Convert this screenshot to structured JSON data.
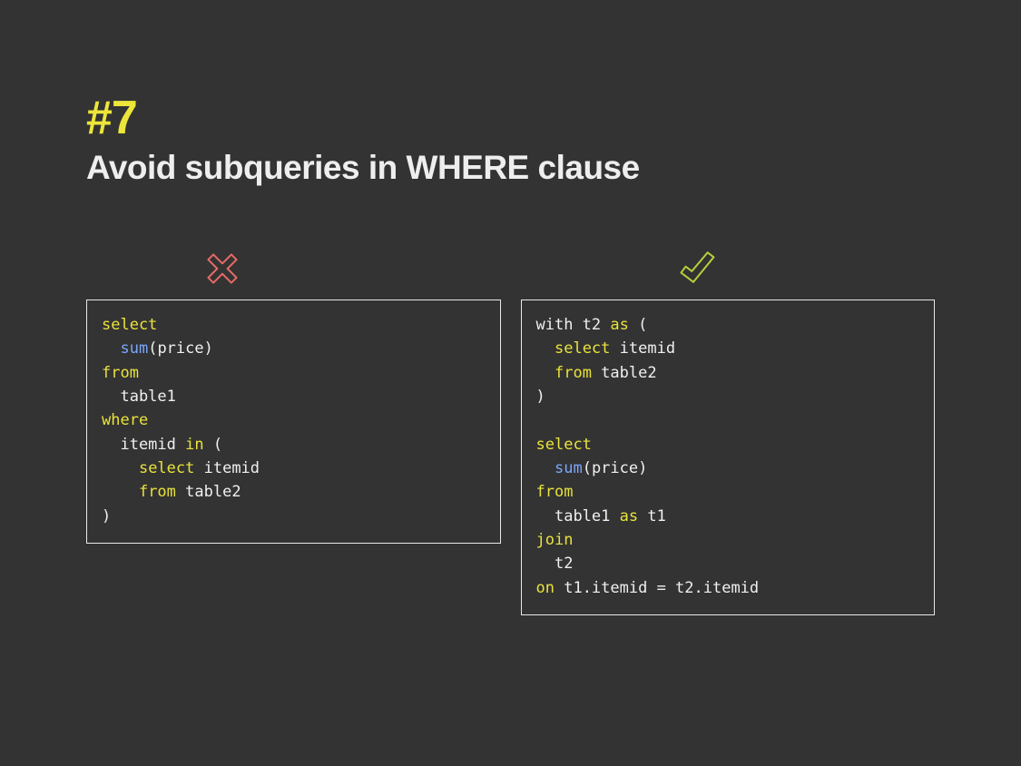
{
  "tip_number": "#7",
  "tip_title": "Avoid subqueries in WHERE clause",
  "colors": {
    "accent_yellow": "#ede539",
    "cross_red": "#e76a66",
    "check_green": "#b4cf3d",
    "bg": "#333333",
    "fg": "#eeeeee",
    "keyword": "#e9e23c",
    "function": "#7aa7ff"
  },
  "bad": {
    "icon": "cross-icon",
    "code_tokens": [
      [
        {
          "c": "kw",
          "t": "select"
        }
      ],
      [
        {
          "c": "plain",
          "t": "  "
        },
        {
          "c": "fn",
          "t": "sum"
        },
        {
          "c": "plain",
          "t": "(price)"
        }
      ],
      [
        {
          "c": "kw",
          "t": "from"
        }
      ],
      [
        {
          "c": "plain",
          "t": "  table1"
        }
      ],
      [
        {
          "c": "kw",
          "t": "where"
        }
      ],
      [
        {
          "c": "plain",
          "t": "  itemid "
        },
        {
          "c": "kw",
          "t": "in"
        },
        {
          "c": "plain",
          "t": " ("
        }
      ],
      [
        {
          "c": "plain",
          "t": "    "
        },
        {
          "c": "kw",
          "t": "select"
        },
        {
          "c": "plain",
          "t": " itemid"
        }
      ],
      [
        {
          "c": "plain",
          "t": "    "
        },
        {
          "c": "kw",
          "t": "from"
        },
        {
          "c": "plain",
          "t": " table2"
        }
      ],
      [
        {
          "c": "plain",
          "t": ")"
        }
      ]
    ]
  },
  "good": {
    "icon": "check-icon",
    "code_tokens": [
      [
        {
          "c": "plain",
          "t": "with t2 "
        },
        {
          "c": "kw",
          "t": "as"
        },
        {
          "c": "plain",
          "t": " ("
        }
      ],
      [
        {
          "c": "plain",
          "t": "  "
        },
        {
          "c": "kw",
          "t": "select"
        },
        {
          "c": "plain",
          "t": " itemid"
        }
      ],
      [
        {
          "c": "plain",
          "t": "  "
        },
        {
          "c": "kw",
          "t": "from"
        },
        {
          "c": "plain",
          "t": " table2"
        }
      ],
      [
        {
          "c": "plain",
          "t": ")"
        }
      ],
      [
        {
          "c": "plain",
          "t": ""
        }
      ],
      [
        {
          "c": "kw",
          "t": "select"
        }
      ],
      [
        {
          "c": "plain",
          "t": "  "
        },
        {
          "c": "fn",
          "t": "sum"
        },
        {
          "c": "plain",
          "t": "(price)"
        }
      ],
      [
        {
          "c": "kw",
          "t": "from"
        }
      ],
      [
        {
          "c": "plain",
          "t": "  table1 "
        },
        {
          "c": "kw",
          "t": "as"
        },
        {
          "c": "plain",
          "t": " t1"
        }
      ],
      [
        {
          "c": "kw",
          "t": "join"
        }
      ],
      [
        {
          "c": "plain",
          "t": "  t2"
        }
      ],
      [
        {
          "c": "kw",
          "t": "on"
        },
        {
          "c": "plain",
          "t": " t1.itemid = t2.itemid"
        }
      ]
    ]
  }
}
